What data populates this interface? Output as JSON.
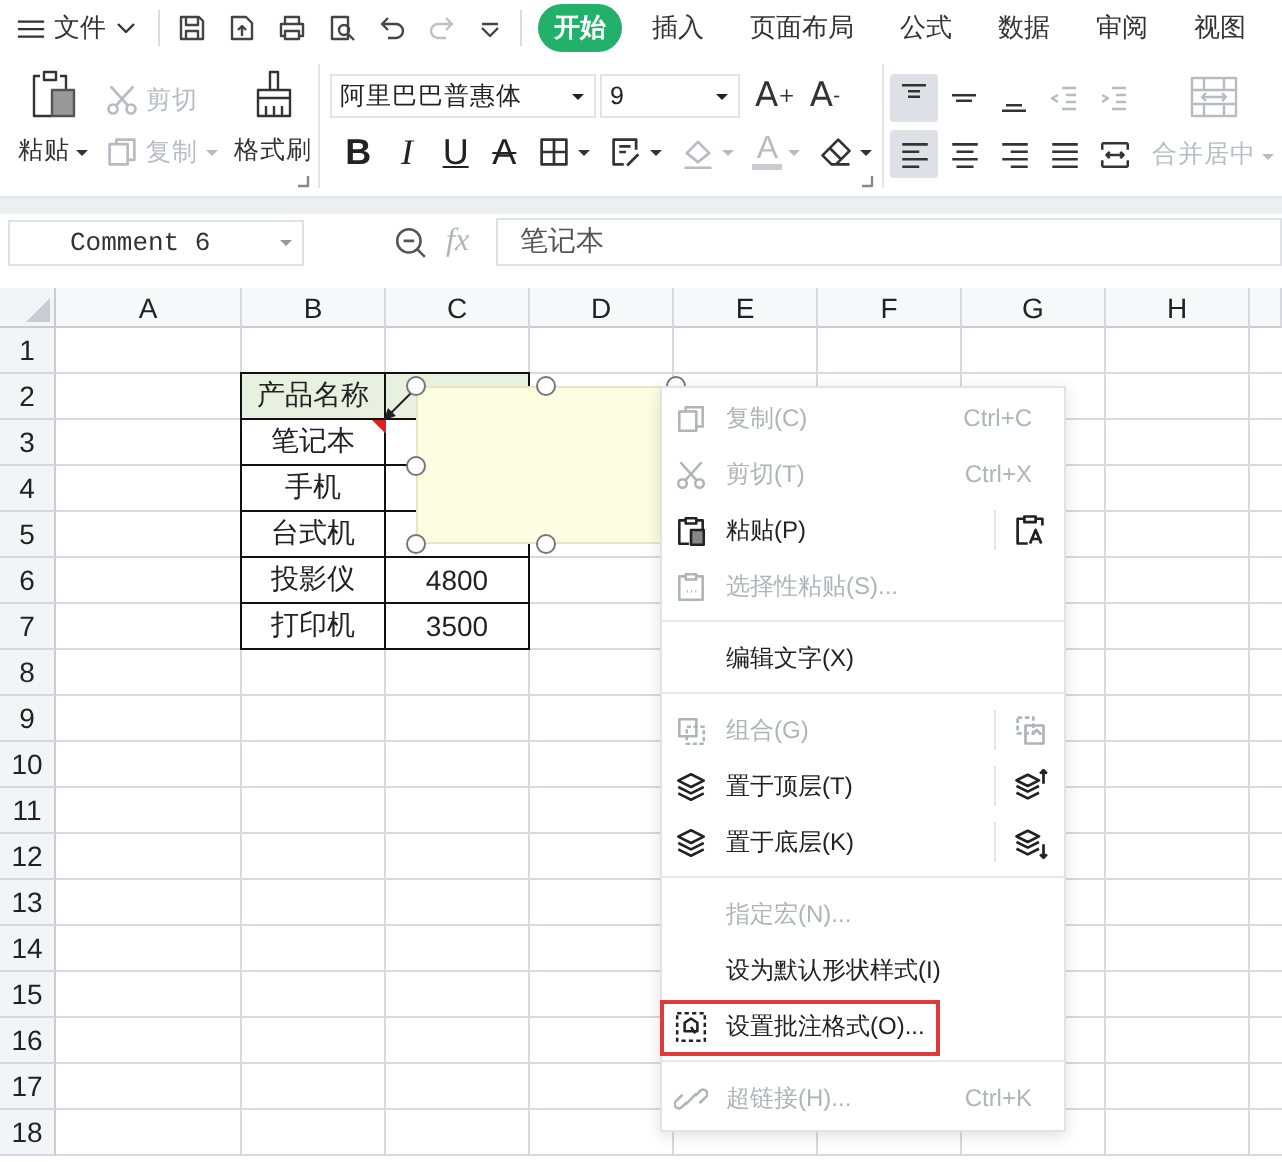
{
  "menu_bar": {
    "file_menu": "文件",
    "quick_access": [
      {
        "disabled": false
      },
      {
        "disabled": false
      },
      {
        "disabled": false
      },
      {
        "disabled": false
      },
      {
        "disabled": false
      },
      {
        "disabled": true
      }
    ],
    "tabs": [
      {
        "label": "开始",
        "selected": true
      },
      {
        "label": "插入",
        "selected": false
      },
      {
        "label": "页面布局",
        "selected": false
      },
      {
        "label": "公式",
        "selected": false
      },
      {
        "label": "数据",
        "selected": false
      },
      {
        "label": "审阅",
        "selected": false
      },
      {
        "label": "视图",
        "selected": false
      }
    ]
  },
  "ribbon": {
    "paste": "粘贴",
    "cut": {
      "label": "剪切",
      "disabled": true
    },
    "copy": {
      "label": "复制",
      "disabled": true
    },
    "format_painter": "格式刷",
    "font_name": "阿里巴巴普惠体",
    "font_size": "9",
    "grow_font": "A$^{+}$",
    "shrink_font": "A$^{-}$",
    "font_styles": [
      {
        "label": "B",
        "kind": "bold"
      },
      {
        "label": "I",
        "kind": "italic"
      },
      {
        "label": "U",
        "kind": "underline"
      },
      {
        "label": "A",
        "kind": "strike"
      }
    ],
    "format_tools": [
      {
        "disabled": false
      },
      {
        "disabled": false
      },
      {
        "disabled": true
      },
      {
        "label": "A",
        "disabled": true
      },
      {
        "disabled": false
      }
    ],
    "vertical_align": [
      {
        "selected": true,
        "disabled": false
      },
      {
        "selected": false,
        "disabled": false
      },
      {
        "selected": false,
        "disabled": false
      },
      {
        "selected": false,
        "disabled": true
      },
      {
        "selected": false,
        "disabled": true
      }
    ],
    "horizontal_align": [
      {
        "selected": true,
        "disabled": false
      },
      {
        "selected": false,
        "disabled": false
      },
      {
        "selected": false,
        "disabled": false
      },
      {
        "selected": false,
        "disabled": false
      },
      {
        "selected": false,
        "disabled": false
      }
    ],
    "merge": {
      "label": "合并居中",
      "disabled": true
    }
  },
  "formula_bar": {
    "name_box": "Comment 6",
    "fx": "fx",
    "formula": "笔记本"
  },
  "sheet": {
    "columns": [
      "A",
      "B",
      "C",
      "D",
      "E",
      "F",
      "G",
      "H"
    ],
    "rows": [
      "1",
      "2",
      "3",
      "4",
      "5",
      "6",
      "7",
      "8",
      "9",
      "10",
      "11",
      "12",
      "13",
      "14",
      "15",
      "16",
      "17",
      "18"
    ],
    "table": [
      {
        "product": "产品名称",
        "header": true
      },
      {
        "product": "笔记本",
        "header": false
      },
      {
        "product": "手机",
        "header": false
      },
      {
        "product": "台式机",
        "header": false
      },
      {
        "product": "投影仪",
        "price": "4800",
        "header": false
      },
      {
        "product": "打印机",
        "price": "3500",
        "header": false
      }
    ]
  },
  "comment": {
    "selected": true
  },
  "context_menu": {
    "items": [
      {
        "kind": "item",
        "label": "复制(C)",
        "shortcut": "Ctrl+C",
        "disabled": true,
        "side_button": false,
        "outlined": false
      },
      {
        "kind": "item",
        "label": "剪切(T)",
        "shortcut": "Ctrl+X",
        "disabled": true,
        "side_button": false,
        "outlined": false
      },
      {
        "kind": "item",
        "label": "粘贴(P)",
        "disabled": false,
        "side_button": true,
        "outlined": false
      },
      {
        "kind": "item",
        "label": "选择性粘贴(S)...",
        "disabled": true,
        "side_button": false,
        "outlined": false
      },
      {
        "kind": "separator"
      },
      {
        "kind": "item",
        "label": "编辑文字(X)",
        "disabled": false,
        "side_button": false,
        "outlined": false
      },
      {
        "kind": "separator"
      },
      {
        "kind": "item",
        "label": "组合(G)",
        "disabled": true,
        "side_button": true,
        "outlined": false
      },
      {
        "kind": "item",
        "label": "置于顶层(T)",
        "disabled": false,
        "side_button": true,
        "outlined": false
      },
      {
        "kind": "item",
        "label": "置于底层(K)",
        "disabled": false,
        "side_button": true,
        "outlined": false
      },
      {
        "kind": "separator"
      },
      {
        "kind": "item",
        "label": "指定宏(N)...",
        "disabled": true,
        "side_button": false,
        "outlined": false
      },
      {
        "kind": "item",
        "label": "设为默认形状样式(I)",
        "disabled": false,
        "side_button": false,
        "outlined": false
      },
      {
        "kind": "item",
        "label": "设置批注格式(O)...",
        "disabled": false,
        "side_button": false,
        "outlined": true
      },
      {
        "kind": "separator"
      },
      {
        "kind": "item",
        "label": "超链接(H)...",
        "shortcut": "Ctrl+K",
        "disabled": true,
        "side_button": false,
        "outlined": false
      }
    ]
  }
}
